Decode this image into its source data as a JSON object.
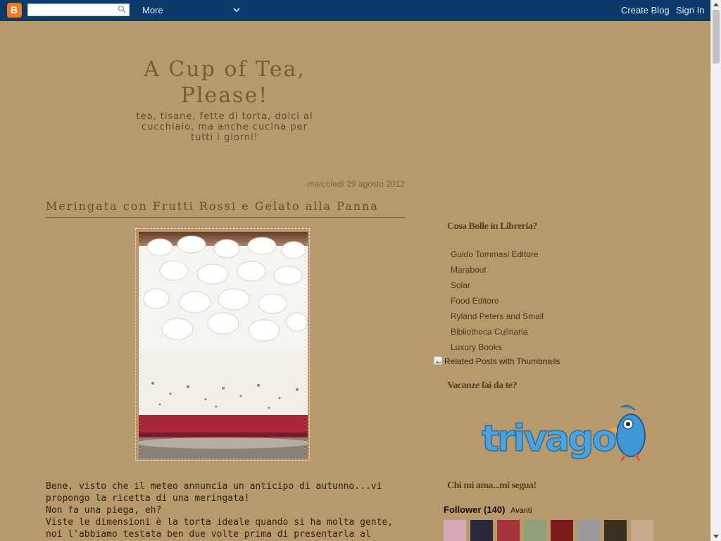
{
  "navbar": {
    "logo_letter": "B",
    "search_placeholder": "",
    "more_label": "More",
    "create_blog_label": "Create Blog",
    "sign_in_label": "Sign In"
  },
  "header": {
    "title": "A Cup of Tea, Please!",
    "description": "tea, tisane, fette di torta, dolci al cucchiaio, ma anche cucina per tutti i giorni!"
  },
  "post": {
    "date": "mercoledì 29 agosto 2012",
    "title": "Meringata con Frutti Rossi e Gelato alla Panna",
    "body": "Bene, visto che il meteo annuncia un anticipo di autunno...vi\npropongo la ricetta di una meringata!\nNon fa una piega, eh?\nViste le dimensioni è la torta ideale quando si ha molta gente,\nnoi l'abbiamo testata ben due volte prima di presentarla al"
  },
  "sidebar": {
    "books_title": "Cosa Bolle in Libreria?",
    "books": [
      "Guido Tommasi Editore",
      "Marabout",
      "Solar",
      "Food Editore",
      "Ryland Peters and Small",
      "Bibliotheca Culinaria",
      "Luxury Books"
    ],
    "related_posts_alt": "Related Posts with Thumbnails",
    "holiday_title": "Vacanze fai da te?",
    "trivago_text": "trivago",
    "followers_title": "Chi mi ama...mi segua!",
    "follower_label": "Follower (140)",
    "follower_next": "Avanti"
  },
  "colors": {
    "page_background": "#b8996b",
    "navbar": "#0c3a6b",
    "title_brown": "#7b5b33",
    "trivago_blue": "#4aa3df",
    "trivago_orange": "#f5a623",
    "trivago_red": "#d9534f"
  }
}
